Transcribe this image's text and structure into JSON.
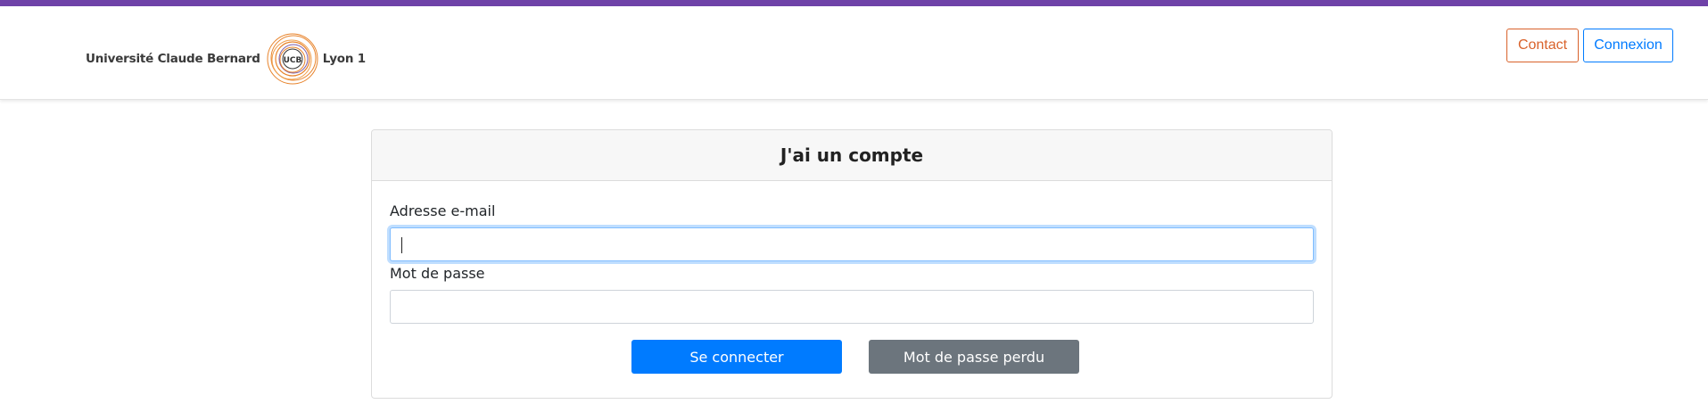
{
  "header": {
    "brand_left": "Université Claude Bernard",
    "brand_seal": "UCB",
    "brand_right": "Lyon 1",
    "contact_label": "Contact",
    "login_label": "Connexion"
  },
  "login_card": {
    "title": "J'ai un compte",
    "email_label": "Adresse e-mail",
    "email_value": "",
    "password_label": "Mot de passe",
    "password_value": "",
    "submit_label": "Se connecter",
    "forgot_label": "Mot de passe perdu"
  },
  "colors": {
    "top_stripe": "#6f42a8",
    "primary": "#007bff",
    "secondary": "#6c757d",
    "contact": "#d9622b"
  }
}
